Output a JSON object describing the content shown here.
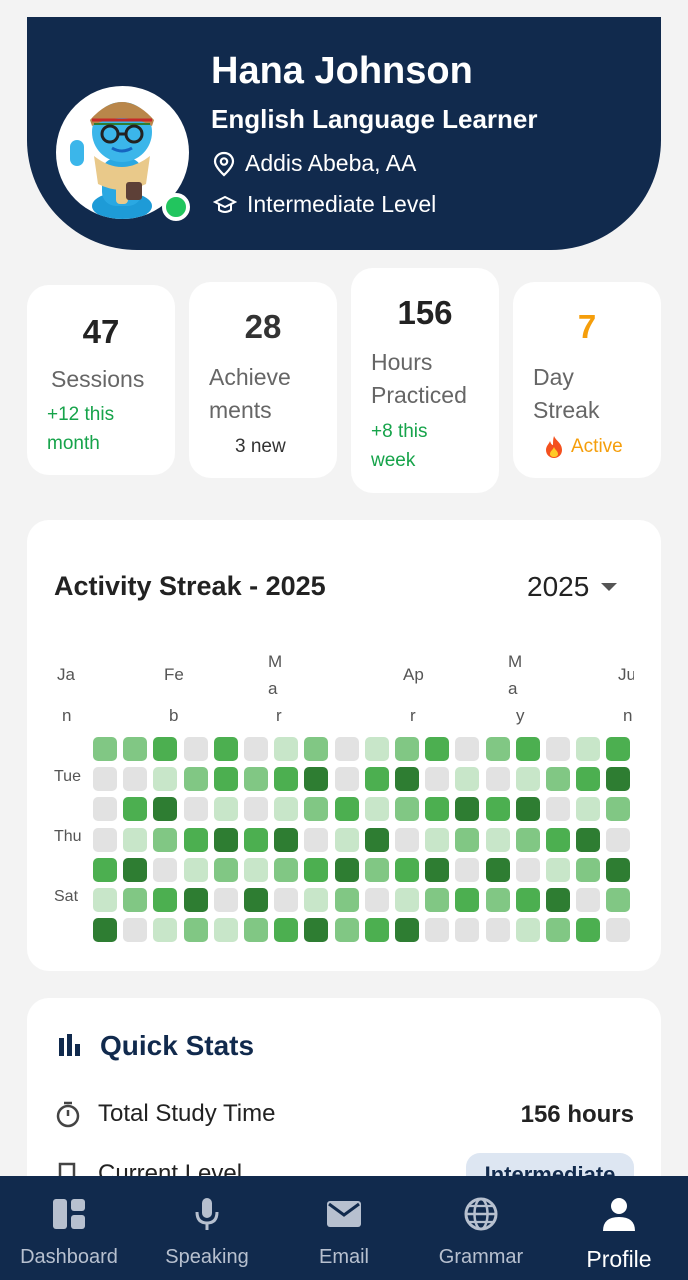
{
  "profile": {
    "name": "Hana Johnson",
    "role": "English Language Learner",
    "location": "Addis Abeba, AA",
    "level": "Intermediate Level",
    "online_color": "#22c55e"
  },
  "stats": [
    {
      "value": "47",
      "label_lines": [
        "Sessions"
      ],
      "sub_lines": [
        "+12 this",
        "month"
      ],
      "color": "#16a34a",
      "icon": ""
    },
    {
      "value": "28",
      "label_lines": [
        "Achieve",
        "ments"
      ],
      "sub_lines": [
        "3 new"
      ],
      "color": "#333333",
      "icon": ""
    },
    {
      "value": "156",
      "label_lines": [
        "Hours",
        "Practiced"
      ],
      "sub_lines": [
        "+8 this",
        "week"
      ],
      "color": "#16a34a",
      "icon": ""
    },
    {
      "value": "7",
      "label_lines": [
        "Day",
        "Streak"
      ],
      "sub_lines": [
        "Active"
      ],
      "color": "#f59e0b",
      "icon": "fire-icon"
    }
  ],
  "activity": {
    "title": "Activity Streak - 2025",
    "year": "2025",
    "months": [
      [
        "Ja",
        "n"
      ],
      [
        "Fe",
        "b"
      ],
      [
        "M",
        "a",
        "r"
      ],
      [
        "Ap",
        "r"
      ],
      [
        "M",
        "a",
        "y"
      ],
      [
        "Ju",
        "n"
      ]
    ],
    "day_labels": [
      "Tue",
      "Thu",
      "Sat"
    ],
    "grid": [
      [
        2,
        2,
        3,
        0,
        3,
        0,
        1,
        2,
        0,
        1,
        2,
        3,
        0,
        2,
        3,
        0,
        1,
        3
      ],
      [
        0,
        0,
        1,
        2,
        3,
        2,
        3,
        4,
        0,
        3,
        4,
        0,
        1,
        0,
        1,
        2,
        3,
        4
      ],
      [
        0,
        3,
        4,
        0,
        1,
        0,
        1,
        2,
        3,
        1,
        2,
        3,
        4,
        3,
        4,
        0,
        1,
        2
      ],
      [
        0,
        1,
        2,
        3,
        4,
        3,
        4,
        0,
        1,
        4,
        0,
        1,
        2,
        1,
        2,
        3,
        4,
        0
      ],
      [
        3,
        4,
        0,
        1,
        2,
        1,
        2,
        3,
        4,
        2,
        3,
        4,
        0,
        4,
        0,
        1,
        2,
        4
      ],
      [
        1,
        2,
        3,
        4,
        0,
        4,
        0,
        1,
        2,
        0,
        1,
        2,
        3,
        2,
        3,
        4,
        0,
        2
      ],
      [
        4,
        0,
        1,
        2,
        1,
        2,
        3,
        4,
        2,
        3,
        4,
        0,
        0,
        0,
        1,
        2,
        3,
        0
      ]
    ],
    "colors": [
      "#e2e2e2",
      "#c8e6c9",
      "#81c784",
      "#4caf50",
      "#2e7d32"
    ]
  },
  "quick_stats": {
    "title": "Quick Stats",
    "total_study_label": "Total Study Time",
    "total_study_value": "156 hours",
    "current_level_label": "Current Level",
    "current_level_value": "Intermediate"
  },
  "nav": [
    {
      "label": "Dashboard",
      "icon": "dashboard-icon"
    },
    {
      "label": "Speaking",
      "icon": "microphone-icon"
    },
    {
      "label": "Email",
      "icon": "email-icon"
    },
    {
      "label": "Grammar",
      "icon": "globe-icon"
    },
    {
      "label": "Profile",
      "icon": "person-icon",
      "active": true
    }
  ]
}
